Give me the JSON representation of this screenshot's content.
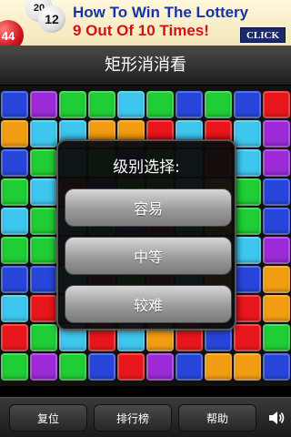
{
  "ad": {
    "balls": [
      "20",
      "12",
      "44"
    ],
    "line1": "How To Win The Lottery",
    "line2": "9 Out Of 10 Times!",
    "click_label": "CLICK"
  },
  "header": {
    "title": "矩形消消看"
  },
  "colors": {
    "r": "#e8161a",
    "g": "#1fcd35",
    "b": "#2646d9",
    "c": "#3fc6ee",
    "p": "#9c2ad8",
    "o": "#f29c12",
    "dim": "#0b0b0b"
  },
  "board": {
    "rows": [
      "bpggcgbgbr",
      "occoorcrcp",
      "bgcgbgcrcp",
      "gcrbggcogb",
      "cgcgbrcogb",
      "ggpgbbpbcp",
      "bbcrgrcobo",
      "crgbcbcbro",
      "rgcrcorbrg",
      "gpgbrpboob"
    ]
  },
  "dialog": {
    "title": "级别选择:",
    "options": [
      "容易",
      "中等",
      "较难"
    ]
  },
  "toolbar": {
    "reset_label": "复位",
    "leaderboard_label": "排行榜",
    "help_label": "帮助"
  }
}
